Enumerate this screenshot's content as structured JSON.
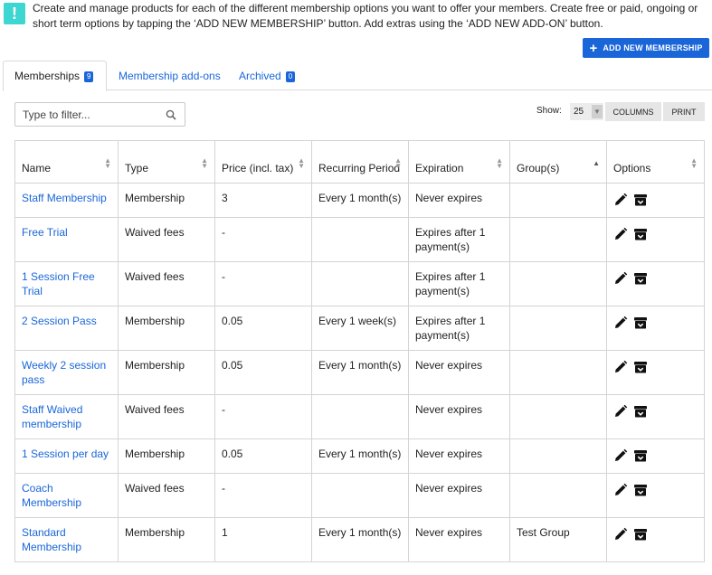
{
  "info": {
    "icon": "exclamation-icon",
    "text": "Create and manage products for each of the different membership options you want to offer your members. Create free or paid, ongoing or short term options by tapping the ‘ADD NEW MEMBERSHIP’ button. Add extras using the ‘ADD NEW ADD-ON’ button."
  },
  "add_button": {
    "label": "ADD NEW MEMBERSHIP",
    "icon": "plus-icon"
  },
  "tabs": [
    {
      "label": "Memberships",
      "badge": "9",
      "active": true
    },
    {
      "label": "Membership add-ons",
      "badge": "",
      "active": false
    },
    {
      "label": "Archived",
      "badge": "0",
      "active": false
    }
  ],
  "filter": {
    "placeholder": "Type to filter...",
    "value": ""
  },
  "show": {
    "label": "Show:",
    "value": "25"
  },
  "toolbar": {
    "columns_label": "COLUMNS",
    "print_label": "PRINT"
  },
  "table": {
    "columns": [
      "Name",
      "Type",
      "Price (incl. tax)",
      "Recurring Period",
      "Expiration",
      "Group(s)",
      "Options"
    ],
    "rows": [
      {
        "name": "Staff Membership",
        "type": "Membership",
        "price": "3",
        "period": "Every 1 month(s)",
        "expiration": "Never expires",
        "groups": ""
      },
      {
        "name": "Free Trial",
        "type": "Waived fees",
        "price": "-",
        "period": "",
        "expiration": "Expires after 1 payment(s)",
        "groups": ""
      },
      {
        "name": "1 Session Free Trial",
        "type": "Waived fees",
        "price": "-",
        "period": "",
        "expiration": "Expires after 1 payment(s)",
        "groups": ""
      },
      {
        "name": "2 Session Pass",
        "type": "Membership",
        "price": "0.05",
        "period": "Every 1 week(s)",
        "expiration": "Expires after 1 payment(s)",
        "groups": ""
      },
      {
        "name": "Weekly 2 session pass",
        "type": "Membership",
        "price": "0.05",
        "period": "Every 1 month(s)",
        "expiration": "Never expires",
        "groups": ""
      },
      {
        "name": "Staff Waived membership",
        "type": "Waived fees",
        "price": "-",
        "period": "",
        "expiration": "Never expires",
        "groups": ""
      },
      {
        "name": "1 Session per day",
        "type": "Membership",
        "price": "0.05",
        "period": "Every 1 month(s)",
        "expiration": "Never expires",
        "groups": ""
      },
      {
        "name": "Coach Membership",
        "type": "Waived fees",
        "price": "-",
        "period": "",
        "expiration": "Never expires",
        "groups": ""
      },
      {
        "name": "Standard Membership",
        "type": "Membership",
        "price": "1",
        "period": "Every 1 month(s)",
        "expiration": "Never expires",
        "groups": "Test Group"
      }
    ]
  },
  "colors": {
    "accent": "#1a66d9",
    "info": "#3dd6d0"
  }
}
